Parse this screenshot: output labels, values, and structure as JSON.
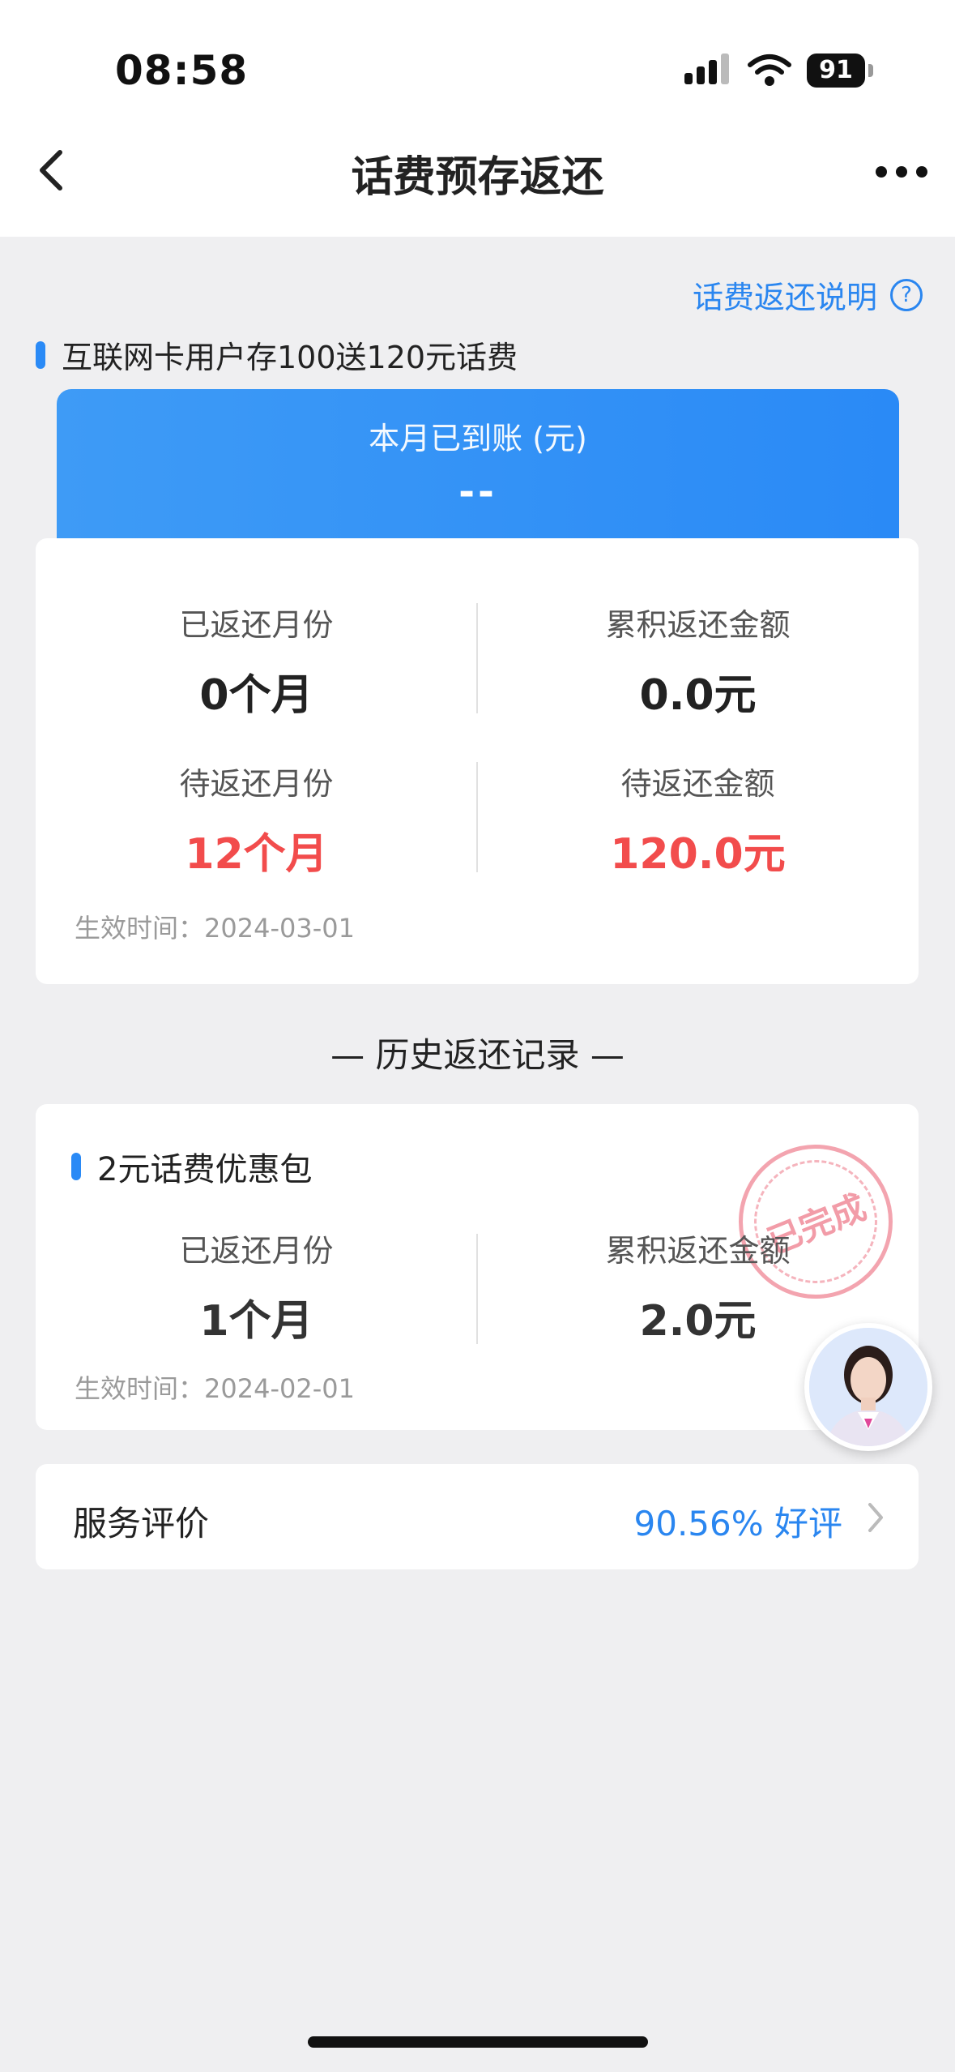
{
  "status_bar": {
    "time": "08:58",
    "battery": "91"
  },
  "nav": {
    "title": "话费预存返还"
  },
  "help_link": {
    "label": "话费返还说明",
    "icon": "?"
  },
  "promo": {
    "title": "互联网卡用户存100送120元话费",
    "banner_label": "本月已到账 (元)",
    "banner_value": "--",
    "stats": {
      "returned_months_label": "已返还月份",
      "returned_months_value": "0个月",
      "accumulated_amount_label": "累积返还金额",
      "accumulated_amount_value": "0.0元",
      "pending_months_label": "待返还月份",
      "pending_months_value": "12个月",
      "pending_amount_label": "待返还金额",
      "pending_amount_value": "120.0元"
    },
    "effective_time": "生效时间：2024-03-01"
  },
  "history": {
    "title": "— 历史返还记录 —",
    "records": [
      {
        "title": "2元话费优惠包",
        "stamp": "已完成",
        "returned_months_label": "已返还月份",
        "returned_months_value": "1个月",
        "accumulated_amount_label": "累积返还金额",
        "accumulated_amount_value": "2.0元",
        "effective_time": "生效时间：2024-02-01"
      }
    ]
  },
  "service_rating": {
    "label": "服务评价",
    "value": "90.56% 好评"
  },
  "colors": {
    "accent": "#2a86f0",
    "highlight_red": "#f24c4c",
    "background": "#efeff1"
  }
}
